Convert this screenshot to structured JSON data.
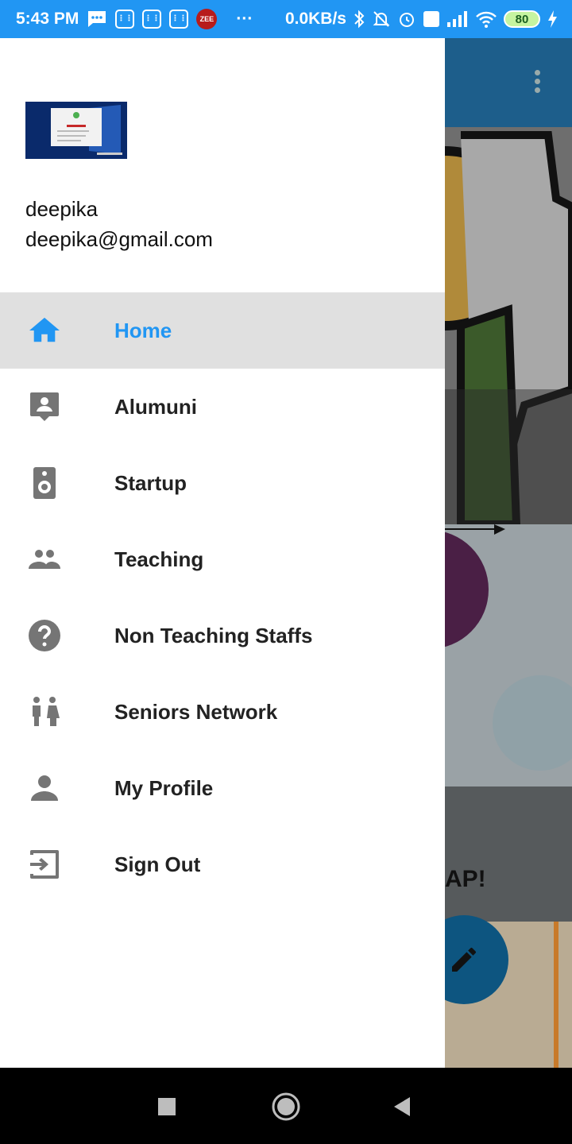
{
  "status_bar": {
    "time": "5:43 PM",
    "net_speed": "0.0KB/s",
    "battery": "80",
    "zee_label": "ZEE",
    "icons": [
      "message-icon",
      "sim-icon",
      "sim-icon",
      "sim-icon",
      "zee-icon",
      "more-icon",
      "bluetooth-icon",
      "bell-off-icon",
      "alarm-icon",
      "volte-icon",
      "signal-icon",
      "wifi-icon",
      "battery-icon",
      "charging-icon"
    ]
  },
  "drawer": {
    "header": {
      "logo_icon": "app-logo-image",
      "name": "deepika",
      "email": "deepika@gmail.com"
    },
    "items": [
      {
        "label": "Home",
        "icon": "home-icon",
        "active": true
      },
      {
        "label": "Alumuni",
        "icon": "contact-icon",
        "active": false
      },
      {
        "label": "Startup",
        "icon": "speaker-icon",
        "active": false
      },
      {
        "label": "Teaching",
        "icon": "people-icon",
        "active": false
      },
      {
        "label": "Non Teaching Staffs",
        "icon": "help-icon",
        "active": false
      },
      {
        "label": "Seniors Network",
        "icon": "wc-icon",
        "active": false
      },
      {
        "label": "My Profile",
        "icon": "person-icon",
        "active": false
      },
      {
        "label": "Sign Out",
        "icon": "exit-icon",
        "active": false
      }
    ]
  },
  "background": {
    "card2_text": "AP!",
    "fab_icon": "edit-icon"
  },
  "colors": {
    "primary": "#2196F3",
    "active_bg": "#e0e0e0",
    "icon_gray": "#757575"
  }
}
